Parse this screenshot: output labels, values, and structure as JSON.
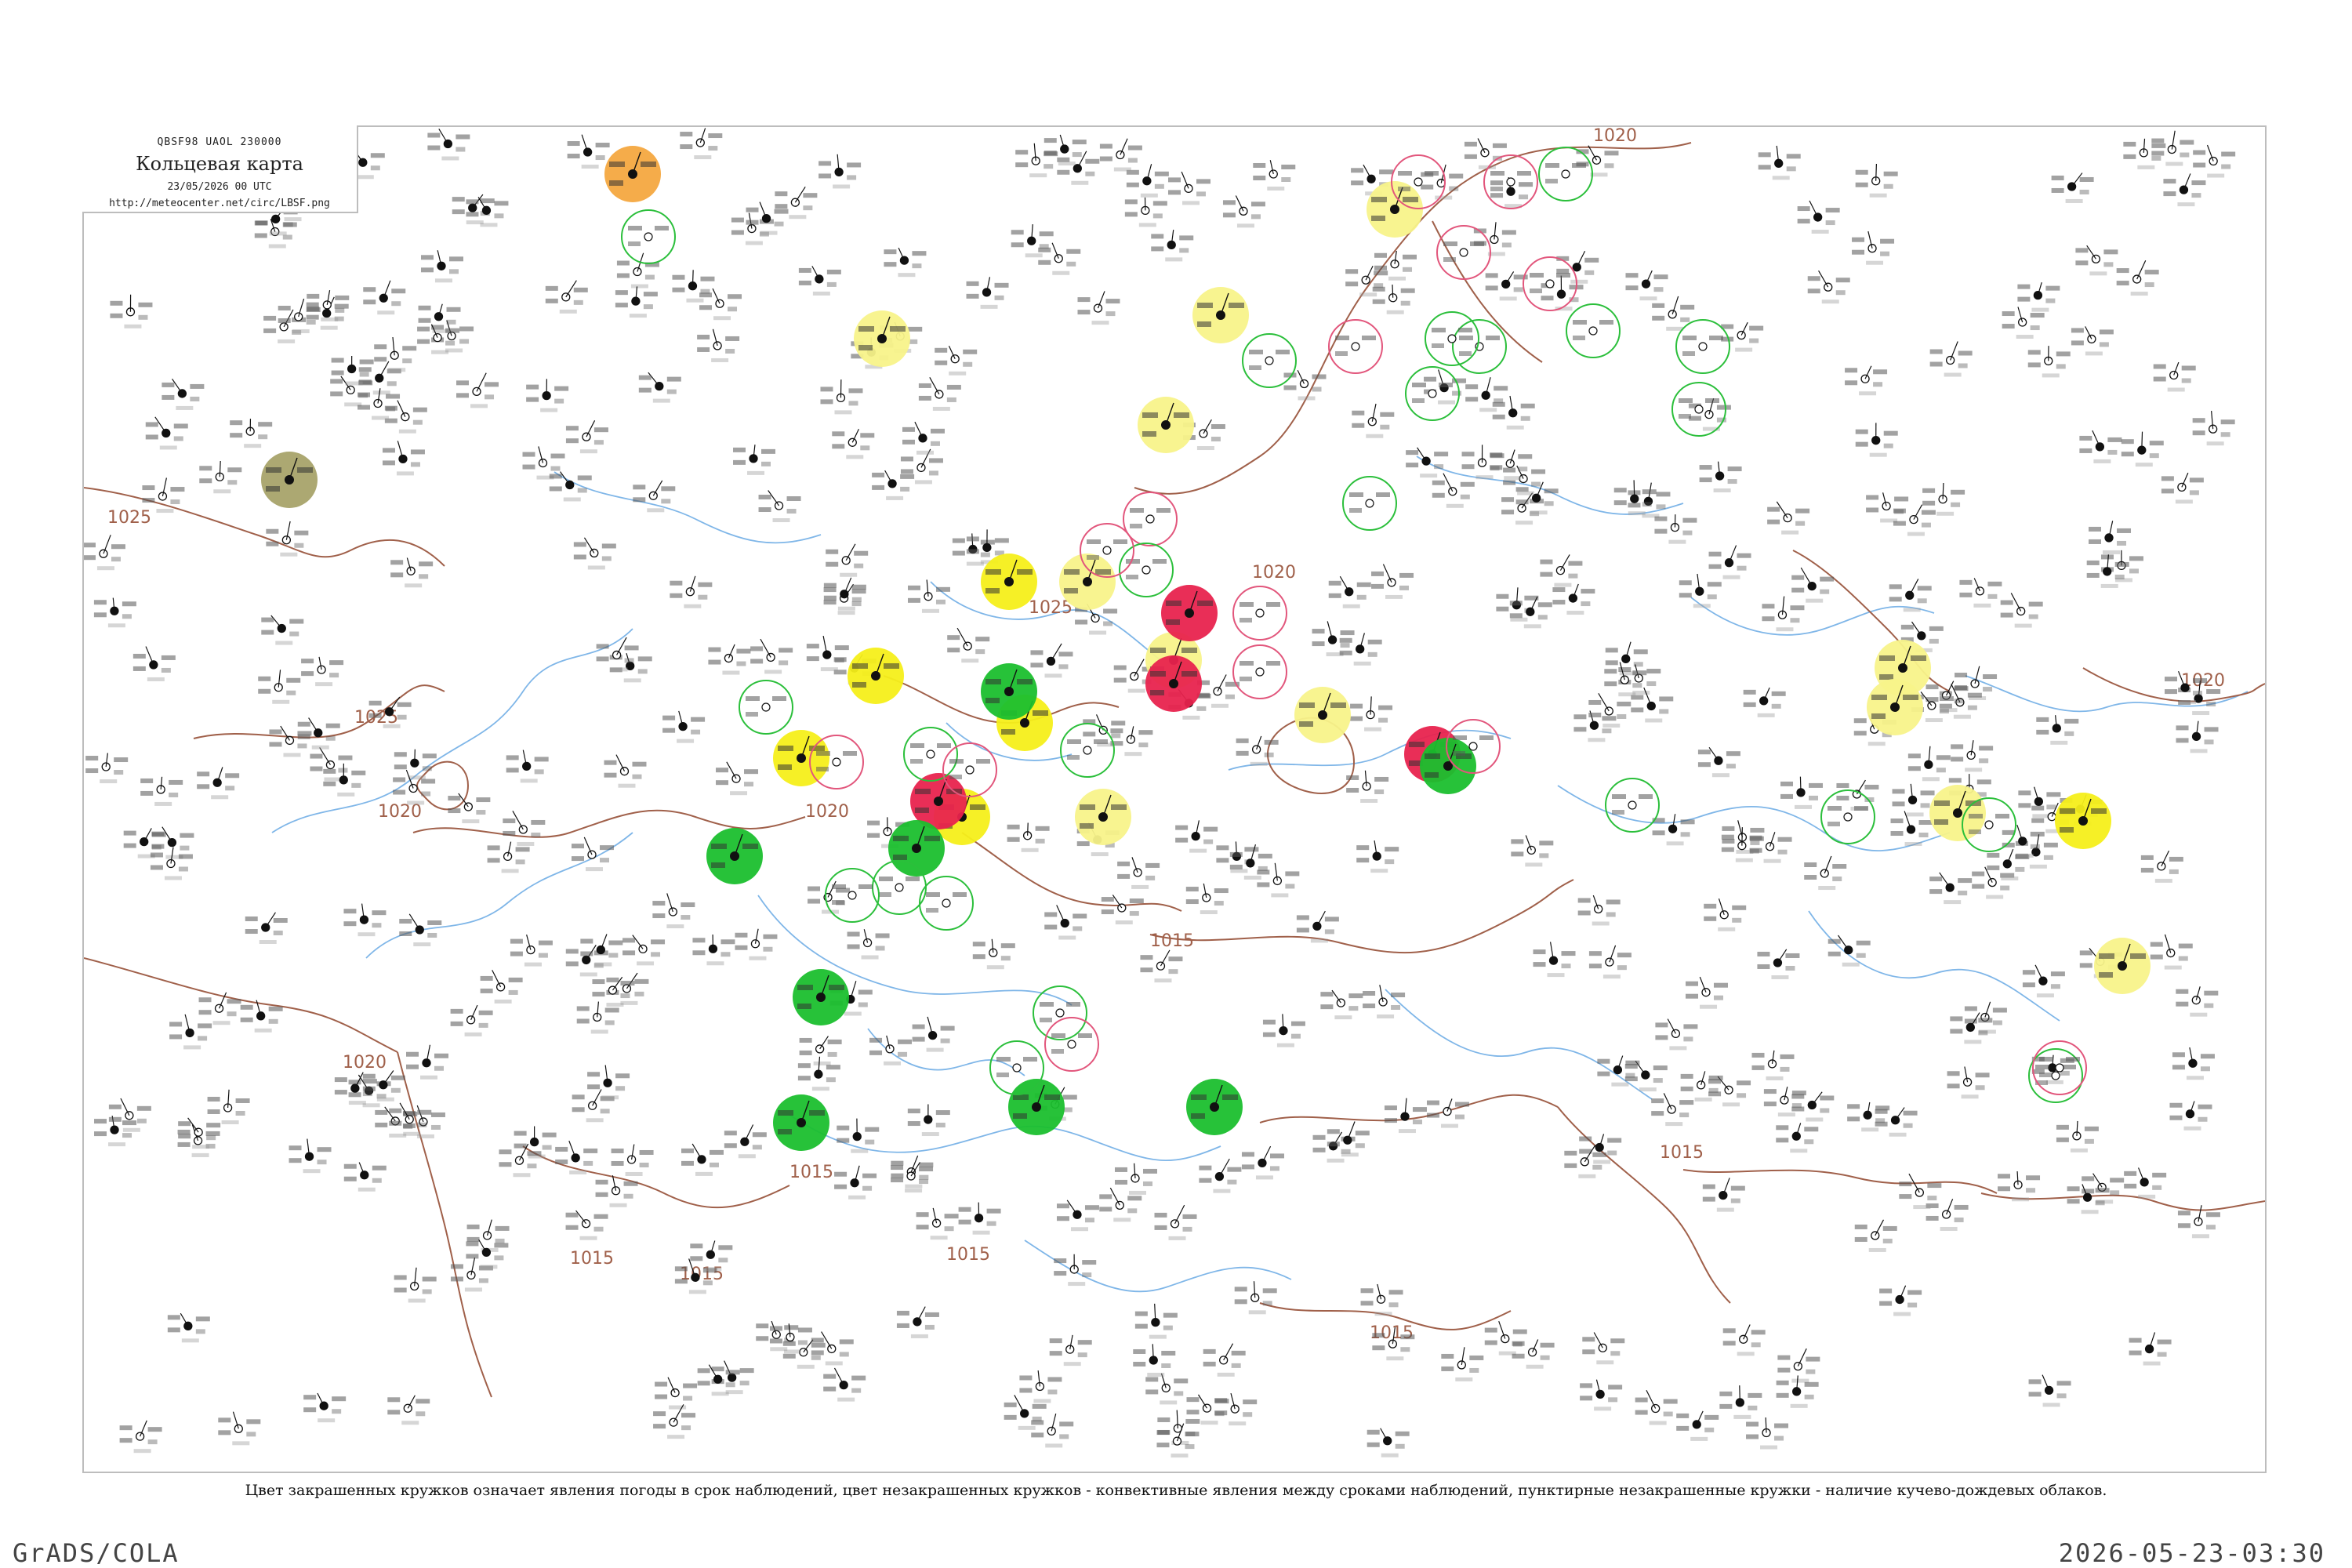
{
  "header": {
    "code": "QBSF98  UAOL  230000",
    "title": "Кольцевая карта",
    "date": "23/05/2026 00 UTC",
    "url": "http://meteocenter.net/circ/LBSF.png"
  },
  "legend_text": "Цвет закрашенных кружков означает явления погоды в срок наблюдений, цвет незакрашенных кружков - конвективные явления между сроками наблюдений, пунктирные незакрашенные кружки - наличие кучево-дождевых облаков.",
  "footer": {
    "left": "GrADS/COLA",
    "right": "2026-05-23-03:30"
  },
  "isobar_labels": [
    "1020",
    "1025",
    "1025",
    "1025",
    "1020",
    "1020",
    "1020",
    "1015",
    "1015",
    "1015",
    "1015",
    "1015",
    "1020",
    "1015",
    "1015",
    "1020"
  ],
  "colors": {
    "isobar": "#a0604a",
    "water": "#7fb6e8",
    "rain_filled": "#1bbf2e",
    "thunder_filled": "#e8234e",
    "fog_filled": "#f5ef1a",
    "haze_filled": "#f8f38a",
    "dust_filled": "#a8a36a",
    "orange_filled": "#f4a840",
    "rain_ring": "#2bbf3b",
    "thunder_ring": "#e2567c"
  }
}
